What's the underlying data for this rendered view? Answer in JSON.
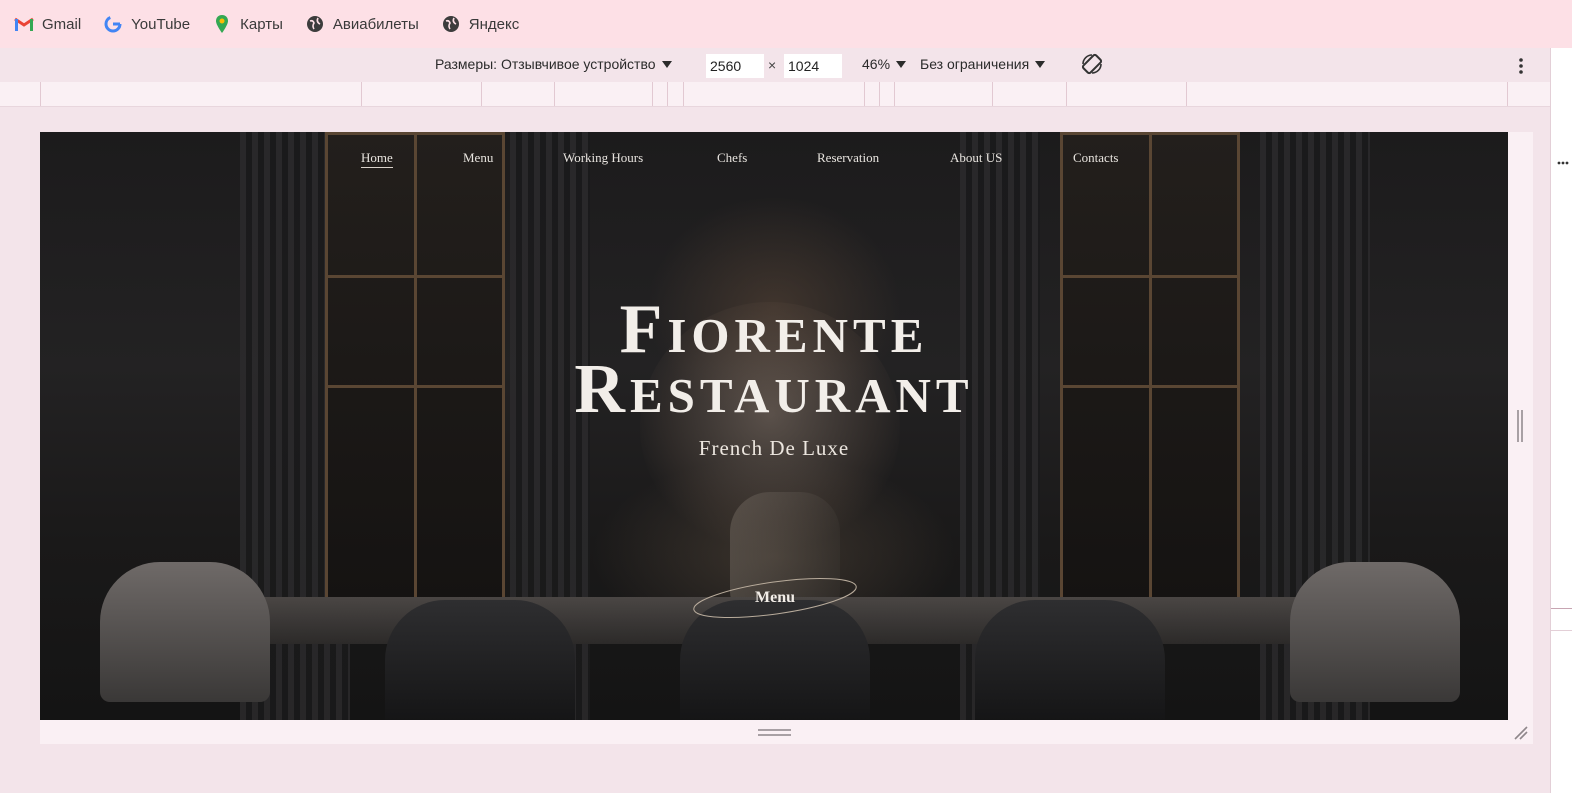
{
  "bookmarks": [
    {
      "label": "Gmail",
      "icon": "gmail-icon"
    },
    {
      "label": "YouTube",
      "icon": "google-icon"
    },
    {
      "label": "Карты",
      "icon": "maps-pin-icon"
    },
    {
      "label": "Авиабилеты",
      "icon": "globe-icon"
    },
    {
      "label": "Яндекс",
      "icon": "globe-icon"
    }
  ],
  "devtools": {
    "dimensions_label": "Размеры: Отзывчивое устройство",
    "width": "2560",
    "height": "1024",
    "times": "×",
    "zoom": "46%",
    "throttle": "Без ограничения"
  },
  "site": {
    "nav": [
      "Home",
      "Menu",
      "Working Hours",
      "Chefs",
      "Reservation",
      "About US",
      "Contacts"
    ],
    "title_line1": "Fiorente",
    "title_line2": "Restaurant",
    "subtitle": "French De Luxe",
    "menu_button": "Menu"
  },
  "colors": {
    "bookmark_bar": "#fde0e6",
    "devtools_bg": "#f3e4ea",
    "hero_text": "#f2eee9"
  }
}
